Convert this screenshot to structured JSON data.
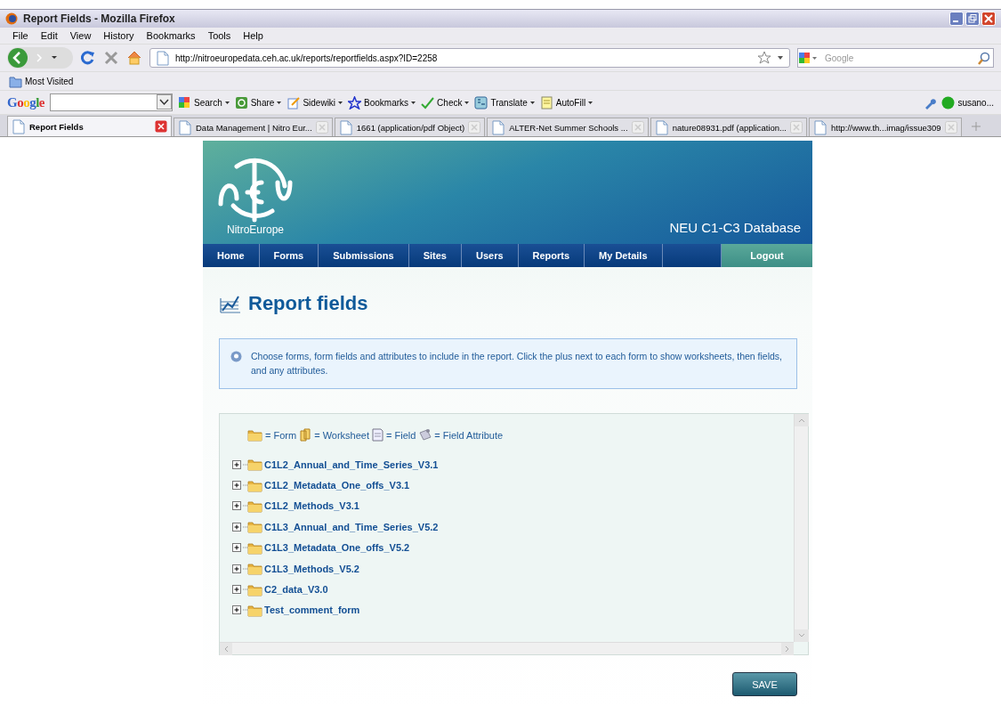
{
  "window": {
    "title": "Report Fields - Mozilla Firefox"
  },
  "menu": [
    "File",
    "Edit",
    "View",
    "History",
    "Bookmarks",
    "Tools",
    "Help"
  ],
  "address": {
    "url": "http://nitroeuropedata.ceh.ac.uk/reports/reportfields.aspx?ID=2258"
  },
  "search": {
    "placeholder": "Google"
  },
  "bookmarks_bar": [
    "Most Visited"
  ],
  "google_toolbar": {
    "logo": "Google",
    "items": [
      "Search",
      "Share",
      "Sidewiki",
      "Bookmarks",
      "Check",
      "Translate",
      "AutoFill"
    ],
    "user": "susano..."
  },
  "tabs": [
    {
      "label": "Report Fields",
      "selected": true
    },
    {
      "label": "Data Management | Nitro Eur...",
      "selected": false
    },
    {
      "label": "1661 (application/pdf Object)",
      "selected": false
    },
    {
      "label": "ALTER-Net Summer Schools ...",
      "selected": false
    },
    {
      "label": "nature08931.pdf (application...",
      "selected": false
    },
    {
      "label": "http://www.th...imag/issue309",
      "selected": false
    }
  ],
  "site": {
    "logo_text": "NitroEurope",
    "database_title": "NEU C1-C3 Database",
    "nav": [
      {
        "label": "Home",
        "kind": "link"
      },
      {
        "label": "Forms",
        "kind": "link"
      },
      {
        "label": "Submissions",
        "kind": "link"
      },
      {
        "label": "Sites",
        "kind": "link"
      },
      {
        "label": "Users",
        "kind": "link"
      },
      {
        "label": "Reports",
        "kind": "link"
      },
      {
        "label": "My Details",
        "kind": "link"
      },
      {
        "label": "Logout",
        "kind": "logout"
      }
    ]
  },
  "heading": "Report fields",
  "info": "Choose forms, form fields and attributes to include in the report. Click the plus next to each form to show worksheets, then fields, and any attributes.",
  "legend": [
    {
      "kind": "form",
      "label": "= Form"
    },
    {
      "kind": "worksheet",
      "label": "= Worksheet"
    },
    {
      "kind": "field",
      "label": "= Field"
    },
    {
      "kind": "attribute",
      "label": "= Field Attribute"
    }
  ],
  "forms": [
    {
      "label": "C1L2_Annual_and_Time_Series_V3.1",
      "expanded": false
    },
    {
      "label": "C1L2_Metadata_One_offs_V3.1",
      "expanded": false
    },
    {
      "label": "C1L2_Methods_V3.1",
      "expanded": false
    },
    {
      "label": "C1L3_Annual_and_Time_Series_V5.2",
      "expanded": false
    },
    {
      "label": "C1L3_Metadata_One_offs_V5.2",
      "expanded": false
    },
    {
      "label": "C1L3_Methods_V5.2",
      "expanded": false
    },
    {
      "label": "C2_data_V3.0",
      "expanded": false
    },
    {
      "label": "Test_comment_form",
      "expanded": false
    }
  ],
  "save_button": "SAVE"
}
